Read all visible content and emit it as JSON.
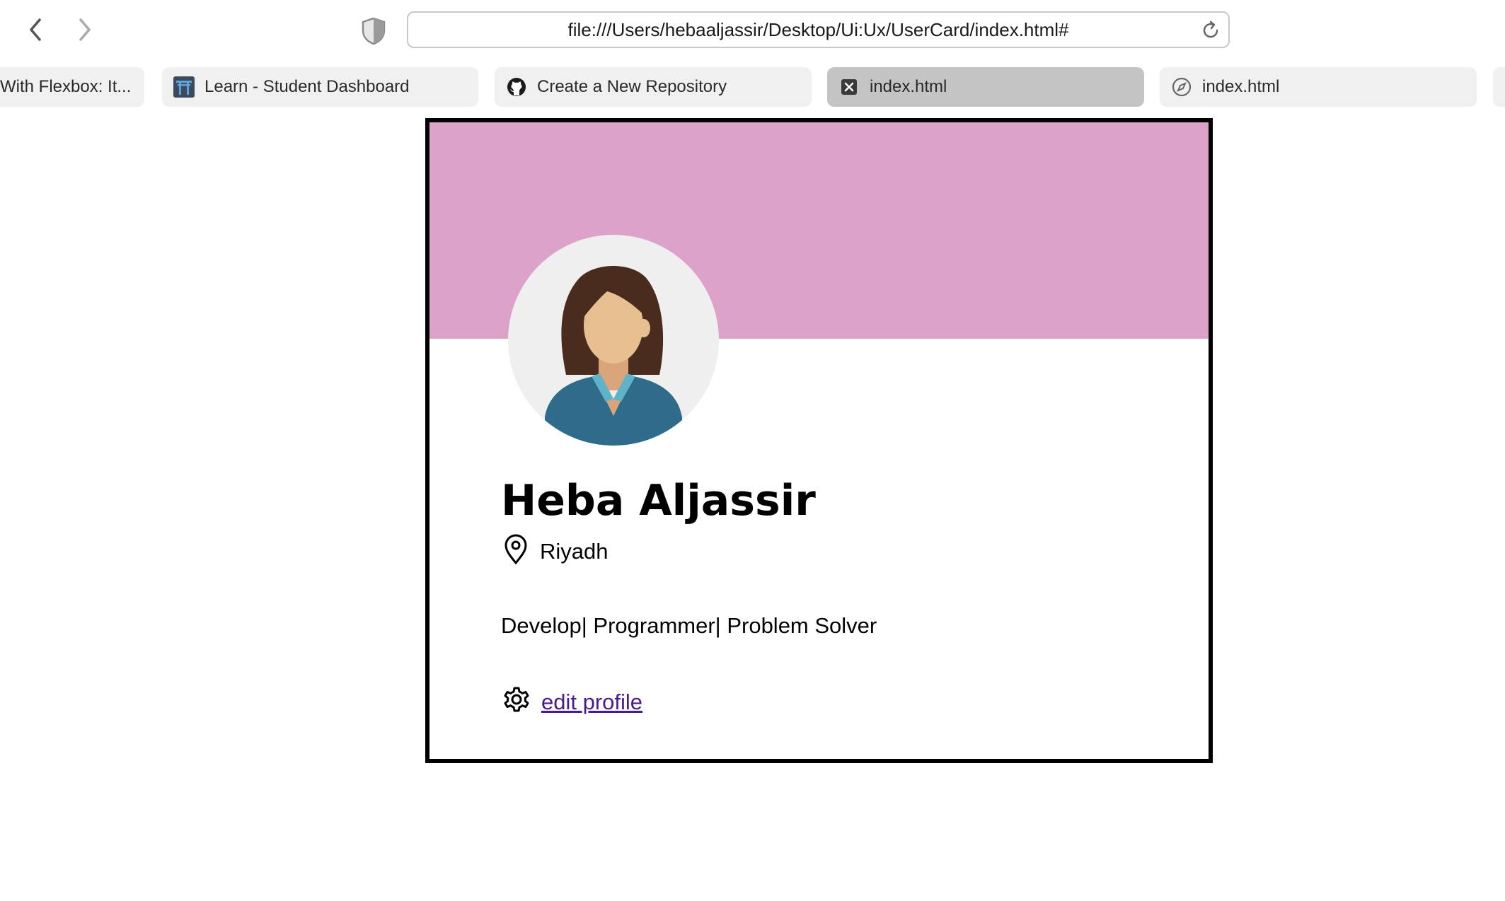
{
  "browser": {
    "back_icon": "chevron-left-icon",
    "forward_icon": "chevron-right-icon",
    "shield_icon": "shield-icon",
    "address": "file:///Users/hebaaljassir/Desktop/Ui:Ux/UserCard/index.html#",
    "reload_icon": "reload-icon",
    "tabs": [
      {
        "label": "With Flexbox: It...",
        "active": false
      },
      {
        "label": "Learn - Student Dashboard",
        "icon": "torii-gate-icon",
        "active": false
      },
      {
        "label": "Create a New Repository",
        "icon": "github-icon",
        "active": false
      },
      {
        "label": "index.html",
        "icon": "close-icon",
        "active": true
      },
      {
        "label": "index.html",
        "icon": "compass-icon",
        "active": false
      },
      {
        "label": "",
        "active": false
      }
    ]
  },
  "card": {
    "banner_color": "#dca2ca",
    "name": "Heba Aljassir",
    "location": "Riyadh",
    "bio": "Develop| Programmer| Problem Solver",
    "edit_label": "edit profile",
    "link_color": "#4b1a8c"
  }
}
